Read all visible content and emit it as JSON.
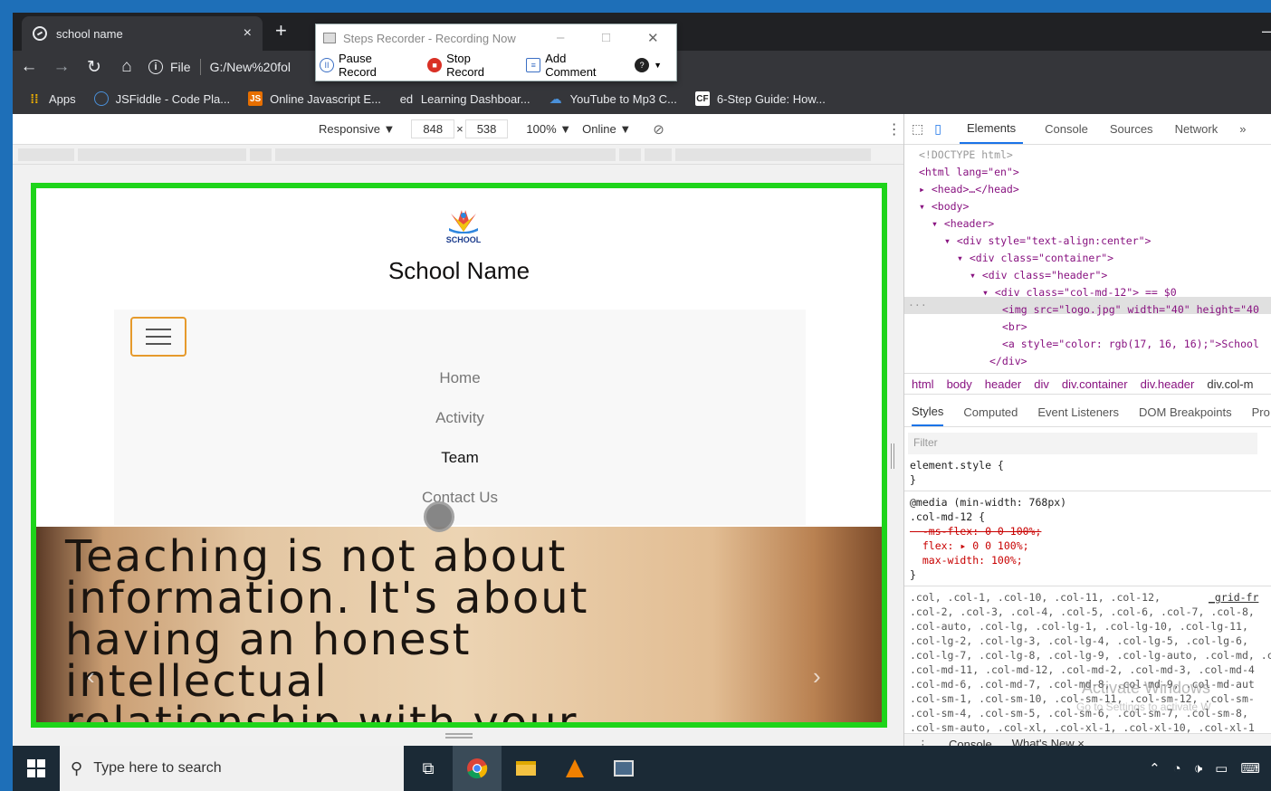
{
  "browser": {
    "tab_title": "school name",
    "tab_close": "×",
    "new_tab": "+",
    "url_file_label": "File",
    "url": "G:/New%20fol",
    "bookmarks": [
      "Apps",
      "JSFiddle - Code Pla...",
      "Online Javascript E...",
      "Learning Dashboar...",
      "YouTube to Mp3 C...",
      "6-Step Guide: How..."
    ]
  },
  "steps_recorder": {
    "title": "Steps Recorder - Recording Now",
    "pause": "Pause Record",
    "stop": "Stop Record",
    "add_comment": "Add Comment"
  },
  "device_toolbar": {
    "mode": "Responsive ▼",
    "width": "848",
    "times": "×",
    "height": "538",
    "zoom": "100% ▼",
    "network": "Online ▼"
  },
  "page": {
    "school_name": "School Name",
    "logo_text": "SCHOOL",
    "nav": [
      "Home",
      "Activity",
      "Team",
      "Contact Us"
    ],
    "quote_lines": [
      "Teaching is not about",
      "information. It's about",
      "having an honest",
      "intellectual",
      "relationship with your"
    ],
    "prev": "‹",
    "next": "›"
  },
  "devtools": {
    "tabs": [
      "Elements",
      "Console",
      "Sources",
      "Network",
      "»"
    ],
    "dom_lines": {
      "doctype": "<!DOCTYPE html>",
      "html": "<html lang=\"en\">",
      "head": "▸ <head>…</head>",
      "body": "▾ <body>",
      "header": "▾ <header>",
      "div_style": "▾ <div style=\"text-align:center\">",
      "div_container": "▾ <div class=\"container\">",
      "div_header": "▾ <div class=\"header\">",
      "div_col": "▾ <div class=\"col-md-12\"> == $0",
      "img": "<img src=\"logo.jpg\" width=\"40\" height=\"40",
      "br": "<br>",
      "a": "<a style=\"color: rgb(17, 16, 16);\">School",
      "close_div": "</div>"
    },
    "breadcrumbs": [
      "html",
      "body",
      "header",
      "div",
      "div.container",
      "div.header",
      "div.col-m"
    ],
    "style_tabs": [
      "Styles",
      "Computed",
      "Event Listeners",
      "DOM Breakpoints",
      "Pro"
    ],
    "filter_placeholder": "Filter",
    "css_text": {
      "element_style": "element.style {\n}",
      "media": "@media (min-width: 768px)\n.col-md-12 {",
      "strike": "  -ms-flex: 0 0 100%;",
      "flex": "  flex: ▸ 0 0 100%;",
      "maxw": "  max-width: 100%;",
      "close": "}",
      "grid_link": "_grid-fr",
      "selectors": ".col, .col-1, .col-10, .col-11, .col-12,\n.col-2, .col-3, .col-4, .col-5, .col-6, .col-7, .col-8,\n.col-auto, .col-lg, .col-lg-1, .col-lg-10, .col-lg-11,\n.col-lg-2, .col-lg-3, .col-lg-4, .col-lg-5, .col-lg-6,\n.col-lg-7, .col-lg-8, .col-lg-9, .col-lg-auto, .col-md, .col-md-1,\n.col-md-11, .col-md-12, .col-md-2, .col-md-3, .col-md-4\n.col-md-6, .col-md-7, .col-md-8, .col-md-9, .col-md-aut\n.col-sm-1, .col-sm-10, .col-sm-11, .col-sm-12, .col-sm-\n.col-sm-4, .col-sm-5, .col-sm-6, .col-sm-7, .col-sm-8,\n.col-sm-auto, .col-xl, .col-xl-1, .col-xl-10, .col-xl-1"
    },
    "watermark": "Activate Windows",
    "watermark_sub": "Go to Settings to activate W",
    "drawer": [
      "Console",
      "What's New ×"
    ]
  },
  "taskbar": {
    "search_placeholder": "Type here to search"
  },
  "colors": {
    "page_border": "#1ed41a",
    "burger_border": "#e69a2c",
    "devtools_accent": "#1a73e8"
  }
}
